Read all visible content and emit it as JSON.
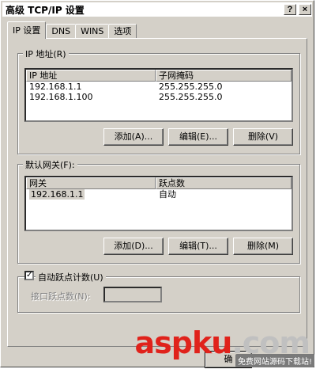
{
  "window": {
    "title": "高级 TCP/IP 设置",
    "help_glyph": "?",
    "close_glyph": "×"
  },
  "tabs": [
    {
      "label": "IP 设置",
      "active": true
    },
    {
      "label": "DNS",
      "active": false
    },
    {
      "label": "WINS",
      "active": false
    },
    {
      "label": "选项",
      "active": false
    }
  ],
  "ip_group": {
    "legend": "IP 地址(R)",
    "columns": [
      "IP 地址",
      "子网掩码"
    ],
    "rows": [
      [
        "192.168.1.1",
        "255.255.255.0"
      ],
      [
        "192.168.1.100",
        "255.255.255.0"
      ]
    ],
    "add_label": "添加(A)...",
    "edit_label": "编辑(E)...",
    "delete_label": "删除(V)"
  },
  "gateway_group": {
    "legend": "默认网关(F):",
    "columns": [
      "网关",
      "跃点数"
    ],
    "rows": [
      [
        "192.168.1.1",
        "自动"
      ]
    ],
    "add_label": "添加(D)...",
    "edit_label": "编辑(T)...",
    "delete_label": "删除(M)"
  },
  "metric": {
    "auto_label": "自动跃点计数(U)",
    "auto_checked": true,
    "check_glyph": "✓",
    "interface_label": "接口跃点数(N):",
    "interface_value": ""
  },
  "footer": {
    "ok_label": "确"
  },
  "watermark": {
    "brand_a": "asp",
    "brand_b": "ku",
    "brand_c": ".com",
    "sub": "免费网站源码下载站!"
  }
}
